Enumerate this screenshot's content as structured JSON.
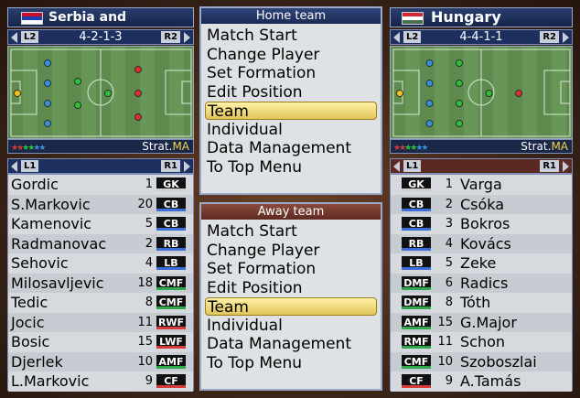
{
  "home": {
    "team_name": "Serbia and Montenegro",
    "formation": "4-2-1-3",
    "l2": "L2",
    "r2": "R2",
    "l1": "L1",
    "r1": "R1",
    "strat_label": "Strat.",
    "strat_value": "MA",
    "players": [
      {
        "name": "Gordic",
        "number": "1",
        "pos": "GK"
      },
      {
        "name": "S.Markovic",
        "number": "20",
        "pos": "CB"
      },
      {
        "name": "Kamenovic",
        "number": "5",
        "pos": "CB"
      },
      {
        "name": "Radmanovac",
        "number": "2",
        "pos": "RB"
      },
      {
        "name": "Sehovic",
        "number": "4",
        "pos": "LB"
      },
      {
        "name": "Milosavljevic",
        "number": "18",
        "pos": "CMF"
      },
      {
        "name": "Tedic",
        "number": "8",
        "pos": "CMF"
      },
      {
        "name": "Jocic",
        "number": "11",
        "pos": "RWF"
      },
      {
        "name": "Bosic",
        "number": "15",
        "pos": "LWF"
      },
      {
        "name": "Djerlek",
        "number": "10",
        "pos": "AMF"
      },
      {
        "name": "L.Markovic",
        "number": "9",
        "pos": "CF"
      }
    ]
  },
  "away": {
    "team_name": "Hungary",
    "formation": "4-4-1-1",
    "l2": "L2",
    "r2": "R2",
    "l1": "L1",
    "r1": "R1",
    "strat_label": "Strat.",
    "strat_value": "MA",
    "players": [
      {
        "name": "Varga",
        "number": "1",
        "pos": "GK"
      },
      {
        "name": "Csóka",
        "number": "2",
        "pos": "CB"
      },
      {
        "name": "Bokros",
        "number": "3",
        "pos": "CB"
      },
      {
        "name": "Kovács",
        "number": "4",
        "pos": "RB"
      },
      {
        "name": "Zeke",
        "number": "5",
        "pos": "LB"
      },
      {
        "name": "Radics",
        "number": "6",
        "pos": "DMF"
      },
      {
        "name": "Tóth",
        "number": "8",
        "pos": "DMF"
      },
      {
        "name": "G.Major",
        "number": "15",
        "pos": "AMF"
      },
      {
        "name": "Schon",
        "number": "11",
        "pos": "RMF"
      },
      {
        "name": "Szoboszlai",
        "number": "10",
        "pos": "CMF"
      },
      {
        "name": "A.Tamás",
        "number": "9",
        "pos": "CF"
      }
    ]
  },
  "home_menu": {
    "title": "Home team",
    "items": [
      "Match Start",
      "Change Player",
      "Set Formation",
      "Edit Position",
      "Team",
      "Individual",
      "Data Management",
      "To Top Menu"
    ],
    "selected": "Team"
  },
  "away_menu": {
    "title": "Away team",
    "items": [
      "Match Start",
      "Change Player",
      "Set Formation",
      "Edit Position",
      "Team",
      "Individual",
      "Data Management",
      "To Top Menu"
    ],
    "selected": "Team"
  },
  "colors": {
    "gk": "#f0c020",
    "defender": "#3b8fd8",
    "midfielder": "#2fbf3a",
    "forward": "#d8302c"
  }
}
